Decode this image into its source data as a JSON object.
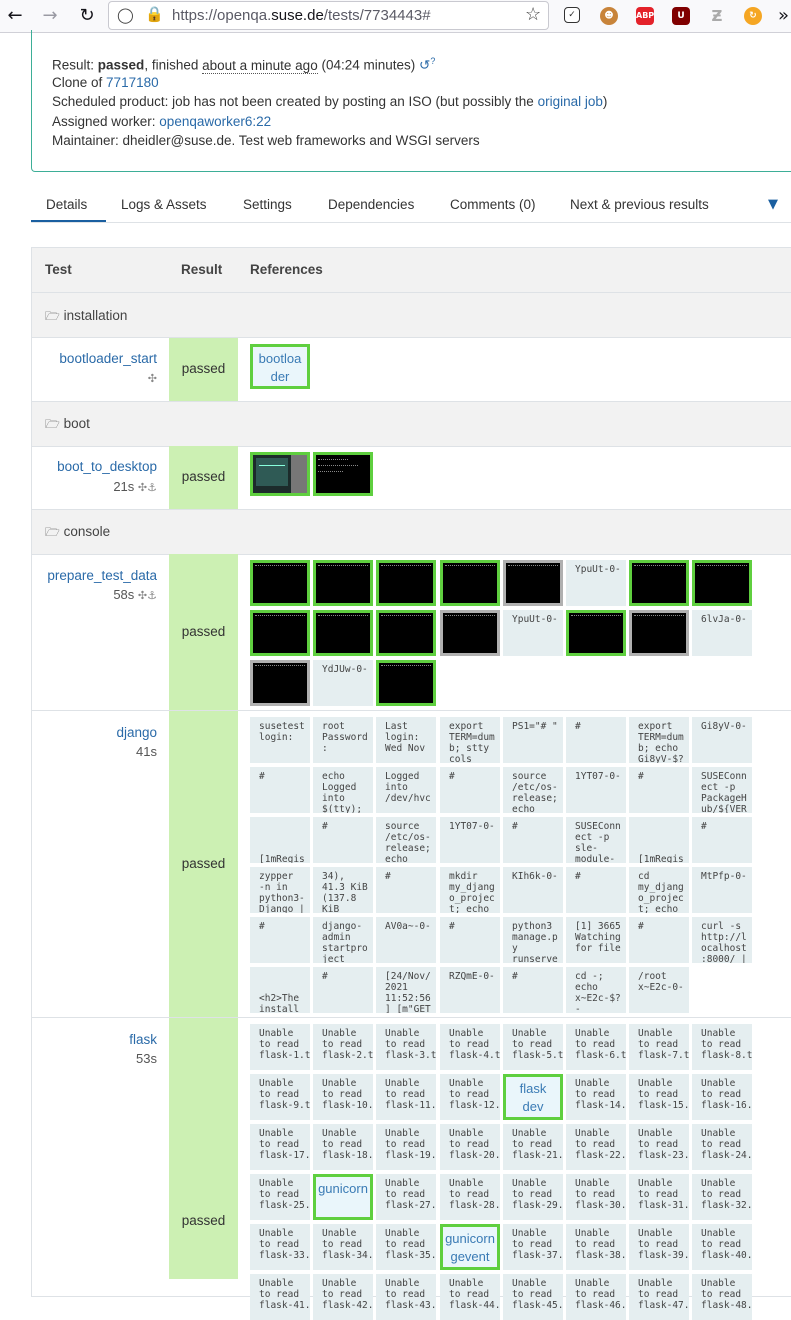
{
  "browser": {
    "url_prefix": "https://openqa.",
    "url_domain": "suse.de",
    "url_suffix": "/tests/7734443#",
    "icons": [
      "back-icon",
      "forward-icon",
      "reload-icon",
      "shield-icon",
      "lock-icon",
      "star-icon",
      "pocket-icon",
      "monkey-icon",
      "adblock-icon",
      "ublock-icon",
      "zotero-icon",
      "sync-icon",
      "more-icon"
    ],
    "abp_label": "ABP",
    "ublock_label": "U"
  },
  "info": {
    "result_label": "Result: ",
    "result_value": "passed",
    "finished_label": ", finished ",
    "finished_value": "about a minute ago",
    "duration": " (04:24 minutes)",
    "clone_label": "Clone of ",
    "clone_id": "7717180",
    "scheduled_text": "Scheduled product: job has not been created by posting an ISO (but possibly the ",
    "original_job": "original job",
    "scheduled_close": ")",
    "worker_label": "Assigned worker: ",
    "worker_value": "openqaworker6:22",
    "maintainer": "Maintainer: dheidler@suse.de. Test web frameworks and WSGI servers"
  },
  "tabs": [
    "Details",
    "Logs & Assets",
    "Settings",
    "Dependencies",
    "Comments (0)",
    "Next & previous results"
  ],
  "table": {
    "headers": [
      "Test",
      "Result",
      "References"
    ],
    "sections": [
      "installation",
      "boot",
      "console"
    ],
    "rows": [
      {
        "name": "bootloader_start",
        "time": "",
        "result": "passed"
      },
      {
        "name": "boot_to_desktop",
        "time": "21s",
        "result": "passed"
      },
      {
        "name": "prepare_test_data",
        "time": "58s",
        "result": "passed"
      },
      {
        "name": "django",
        "time": "41s",
        "result": "passed"
      },
      {
        "name": "flask",
        "time": "53s",
        "result": "passed"
      }
    ],
    "bootloader_thumb": "bootloa\nder",
    "prepare_texts": [
      "YpuUt-0-",
      "YpuUt-0-",
      "6lvJa-0-",
      "YdJUw-0-"
    ],
    "django_texts": [
      "susetest\nlogin:",
      "root\nPassword\n:",
      "Last\nlogin:\nWed Nov",
      "export\nTERM=dum\nb; stty\ncols",
      "PS1=\"# \"",
      "#",
      "export\nTERM=dum\nb; echo\nGi8yV-$?",
      "Gi8yV-0-",
      "#",
      "echo\nLogged\ninto\n$(tty);",
      "Logged\ninto\n/dev/hvc",
      "#",
      "source\n/etc/os-\nrelease;\necho",
      "1YT07-0-",
      "#",
      "SUSEConn\nect -p\nPackageH\nub/${VER",
      "\n\n\n[1mRegis\ntering",
      "#",
      "source\n/etc/os-\nrelease;\necho",
      "1YT07-0-",
      "#",
      "SUSEConn\nect -p\nsle-\nmodule-",
      "\n\n\n[1mRegis\ntering",
      "#",
      "zypper\n-n in\npython3-\nDjango |",
      "34),\n41.3 KiB\n(137.8\nKiB",
      "#",
      "mkdir\nmy_djang\no_projec\nt; echo",
      "KIh6k-0-",
      "#",
      "cd\nmy_djang\no_projec\nt; echo",
      "MtPfp-0-",
      "#",
      "django-\nadmin\nstartpro\nject",
      "AV0a~-0-",
      "#",
      "python3\nmanage.p\ny\nrunserve",
      "[1] 3665\nWatching\nfor file",
      "#",
      "curl -s\nhttp://l\nocalhost\n:8000/ |",
      "\n\n<h2>The\ninstall",
      "#",
      "[24/Nov/\n2021\n11:52:56\n] [m\"GET",
      "RZQmE-0-",
      "#",
      "cd -;\necho\nx~E2c-$?\n-",
      "/root\nx~E2c-0-"
    ],
    "flask_prefix": "Unable\nto read\nflask-",
    "flask_suffix": ".txt.",
    "flask_special": {
      "13": "flask\ndev",
      "26": "gunicorn",
      "36": "gunicorn\ngevent"
    }
  },
  "colors": {
    "accent": "#3dae97",
    "link": "#2a6aa8",
    "passed_bg": "#ccf0b3",
    "thumb_ok": "#5fcf3f"
  }
}
